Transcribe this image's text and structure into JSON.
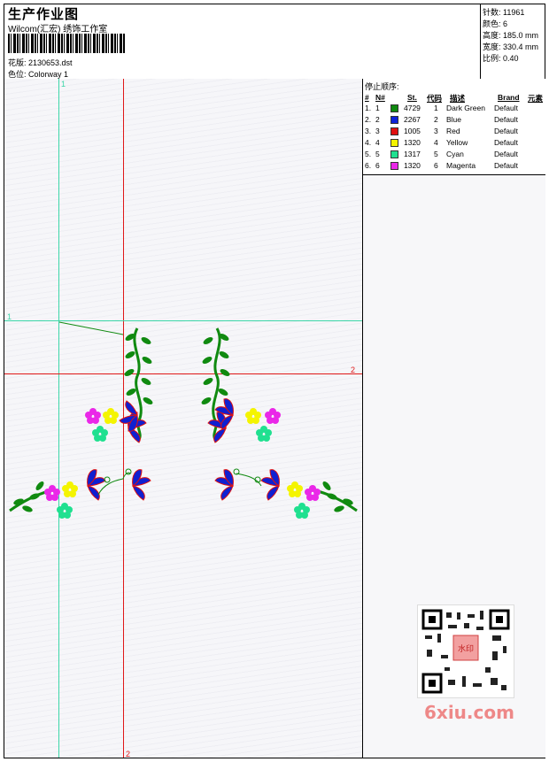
{
  "header": {
    "title": "生产作业图",
    "subtitle": "Wilcom(汇宏) 绣饰工作室",
    "file_label": "花版: 2130653.dst",
    "colorway_label": "色位: Colorway 1",
    "stats": {
      "stitches": "针数: 11961",
      "colors": "颜色: 6",
      "height": "高度: 185.0 mm",
      "width": "宽度: 330.4 mm",
      "scale": "比例: 0.40"
    }
  },
  "stop_sequence": {
    "title": "停止顺序:",
    "headers": [
      "#",
      "N#",
      "St.",
      "代码",
      "描述",
      "Brand",
      "元素"
    ],
    "rows": [
      {
        "num": "1.",
        "n": "1",
        "color": "#108a10",
        "stitches": "4729",
        "code": "1",
        "desc": "Dark Green",
        "brand": "Default"
      },
      {
        "num": "2.",
        "n": "2",
        "color": "#0c22d8",
        "stitches": "2267",
        "code": "2",
        "desc": "Blue",
        "brand": "Default"
      },
      {
        "num": "3.",
        "n": "3",
        "color": "#e01010",
        "stitches": "1005",
        "code": "3",
        "desc": "Red",
        "brand": "Default"
      },
      {
        "num": "4.",
        "n": "4",
        "color": "#f4f400",
        "stitches": "1320",
        "code": "4",
        "desc": "Yellow",
        "brand": "Default"
      },
      {
        "num": "5.",
        "n": "5",
        "color": "#20e090",
        "stitches": "1317",
        "code": "5",
        "desc": "Cyan",
        "brand": "Default"
      },
      {
        "num": "6.",
        "n": "6",
        "color": "#ea28e8",
        "stitches": "1320",
        "code": "6",
        "desc": "Magenta",
        "brand": "Default"
      }
    ]
  },
  "canvas": {
    "guide_labels": {
      "v1_top": "1",
      "h1_left": "1",
      "h2_right": "2",
      "v2_bottom": "2"
    }
  },
  "watermark": {
    "logo": "6xiu.com",
    "seal": "水印"
  }
}
